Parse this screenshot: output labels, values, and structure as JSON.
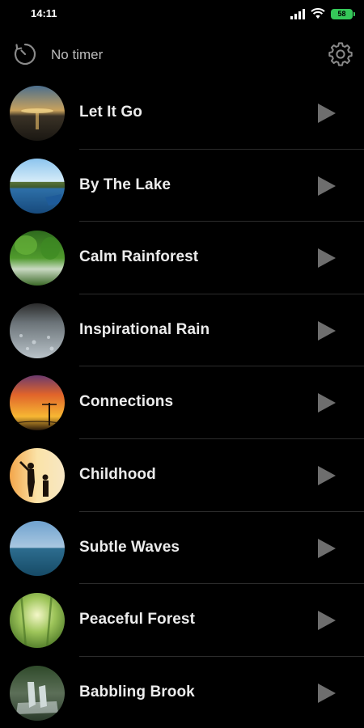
{
  "status_bar": {
    "time": "14:11",
    "battery": "58",
    "icons": [
      "signal-icon",
      "wifi-icon",
      "battery-icon"
    ]
  },
  "header": {
    "timer_label": "No timer",
    "timer_icon": "timer-icon",
    "settings_icon": "gear-icon"
  },
  "tracks": [
    {
      "title": "Let It Go"
    },
    {
      "title": "By The Lake"
    },
    {
      "title": "Calm Rainforest"
    },
    {
      "title": "Inspirational Rain"
    },
    {
      "title": "Connections"
    },
    {
      "title": "Childhood"
    },
    {
      "title": "Subtle Waves"
    },
    {
      "title": "Peaceful Forest"
    },
    {
      "title": "Babbling Brook"
    }
  ],
  "colors": {
    "background": "#000000",
    "text": "#ececec",
    "icon_gray": "#8a8a8a",
    "play_gray": "#6e6e6e",
    "battery_green": "#35c759"
  }
}
